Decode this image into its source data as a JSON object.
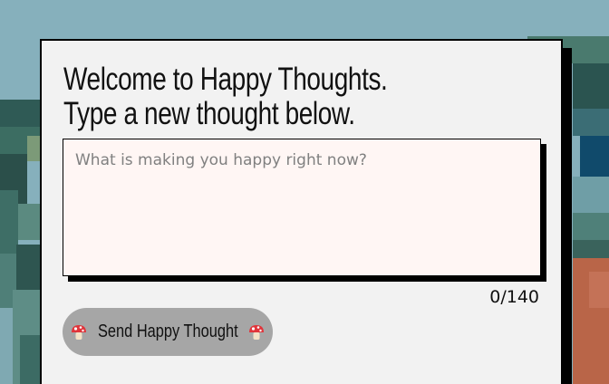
{
  "welcome": {
    "line1": "Welcome to Happy Thoughts.",
    "line2": "Type a new thought below."
  },
  "thought_input": {
    "placeholder": "What is making you happy right now?",
    "value": ""
  },
  "counter": {
    "text": "0/140"
  },
  "send_button": {
    "label": "Send Happy Thought",
    "icon": "mushroom-icon"
  },
  "colors": {
    "background": "#86b0bc",
    "card": "#f2f2f2",
    "textarea": "#fff6f4",
    "button": "#a6a6a6",
    "shadow": "#000000"
  }
}
